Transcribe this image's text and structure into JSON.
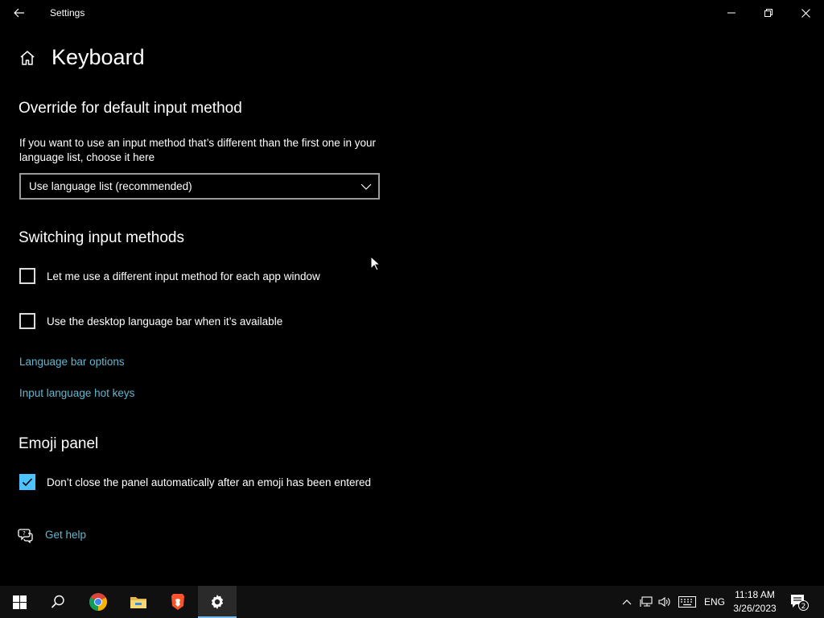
{
  "window": {
    "title": "Settings"
  },
  "page": {
    "title": "Keyboard"
  },
  "override_section": {
    "title": "Override for default input method",
    "description": "If you want to use an input method that’s different than the first one in your language list, choose it here",
    "dropdown_value": "Use language list (recommended)"
  },
  "switching_section": {
    "title": "Switching input methods",
    "checkbox_per_app": {
      "label": "Let me use a different input method for each app window",
      "checked": false
    },
    "checkbox_langbar": {
      "label": "Use the desktop language bar when it’s available",
      "checked": false
    },
    "link_langbar_options": "Language bar options",
    "link_hotkeys": "Input language hot keys"
  },
  "emoji_section": {
    "title": "Emoji panel",
    "checkbox_keep_open": {
      "label": "Don’t close the panel automatically after an emoji has been entered",
      "checked": true
    }
  },
  "help": {
    "label": "Get help"
  },
  "taskbar": {
    "apps": [
      "start-icon",
      "search-icon",
      "chrome-icon",
      "file-explorer-icon",
      "brave-icon",
      "settings-icon"
    ],
    "active_app": "settings",
    "tray": {
      "language": "ENG",
      "time": "11:18 AM",
      "date": "3/26/2023",
      "notification_count": "2"
    }
  },
  "colors": {
    "background": "#000000",
    "link": "#62b6cf",
    "checkbox_checked": "#4cc2ff",
    "taskbar": "#101010"
  }
}
